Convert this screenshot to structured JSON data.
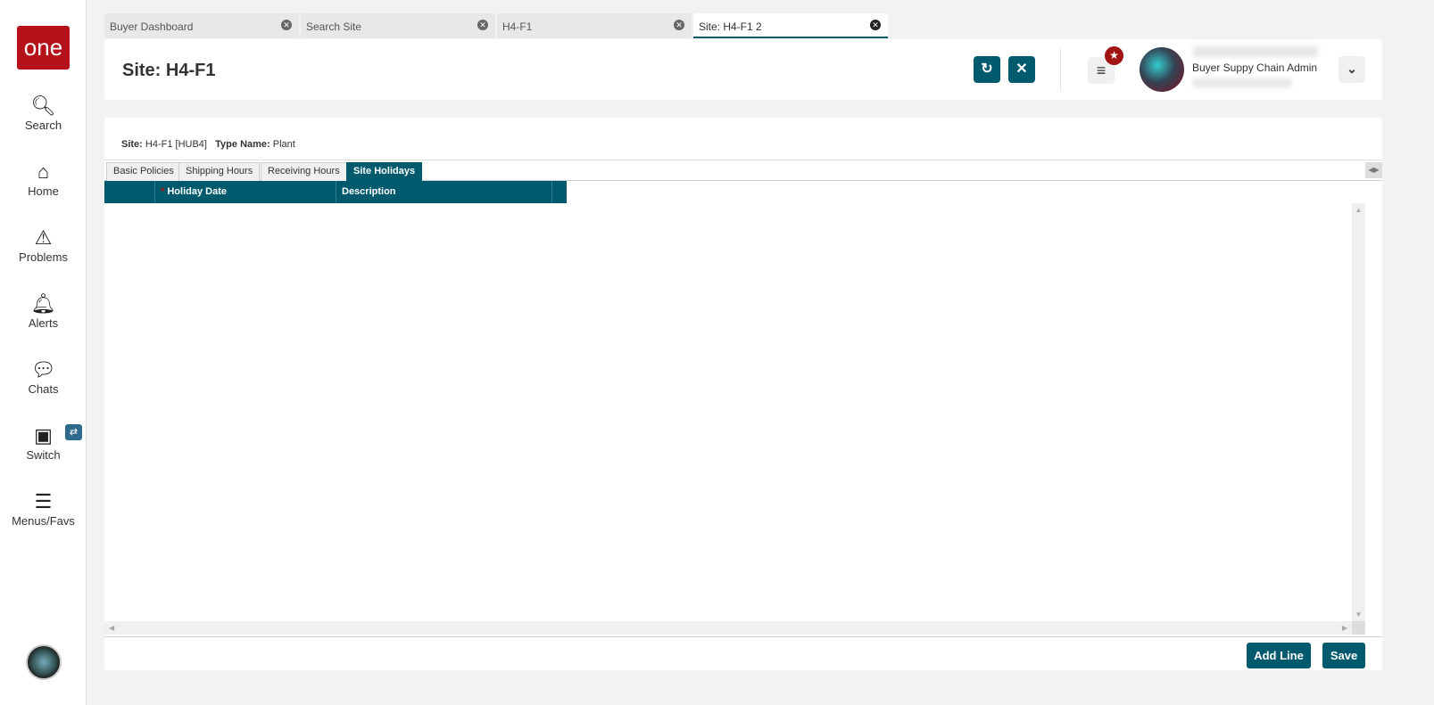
{
  "sidebar": {
    "logo": "one",
    "items": [
      {
        "label": "Search",
        "icon": "search-icon"
      },
      {
        "label": "Home",
        "icon": "home-icon"
      },
      {
        "label": "Problems",
        "icon": "warning-icon"
      },
      {
        "label": "Alerts",
        "icon": "bell-icon"
      },
      {
        "label": "Chats",
        "icon": "chat-icon"
      },
      {
        "label": "Switch",
        "icon": "switch-icon"
      },
      {
        "label": "Menus/Favs",
        "icon": "menu-icon"
      }
    ]
  },
  "tabs": [
    {
      "label": "Buyer Dashboard"
    },
    {
      "label": "Search Site"
    },
    {
      "label": "H4-F1"
    },
    {
      "label": "Site: H4-F1 2"
    }
  ],
  "header": {
    "title": "Site: H4-F1",
    "user_role": "Buyer Suppy Chain Admin"
  },
  "info": {
    "site_label": "Site:",
    "site_value": "H4-F1 [HUB4]",
    "type_label": "Type Name:",
    "type_value": "Plant"
  },
  "subtabs": [
    {
      "label": "Basic Policies"
    },
    {
      "label": "Shipping Hours"
    },
    {
      "label": "Receiving Hours"
    },
    {
      "label": "Site Holidays"
    }
  ],
  "grid": {
    "columns": [
      {
        "label": "Holiday Date",
        "required": "*"
      },
      {
        "label": "Description"
      }
    ],
    "rows": []
  },
  "footer": {
    "add_line": "Add Line",
    "save": "Save"
  }
}
